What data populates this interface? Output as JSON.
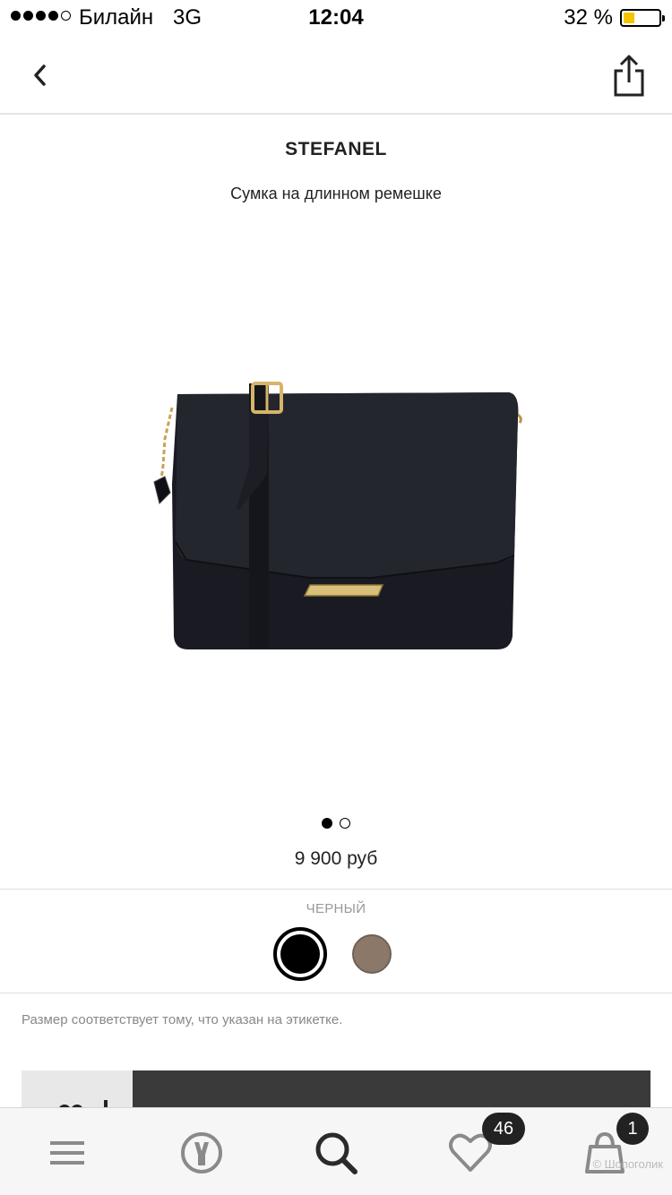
{
  "status_bar": {
    "carrier": "Билайн",
    "network": "3G",
    "time": "12:04",
    "battery_percent_text": "32 %",
    "battery_level": 0.32,
    "signal_bars_filled": 4,
    "signal_bars_total": 5
  },
  "nav": {
    "back_icon": "chevron-left-icon",
    "share_icon": "share-icon"
  },
  "product": {
    "brand": "STEFANEL",
    "name": "Сумка на длинном ремешке",
    "price": "9 900 руб",
    "image_count": 2,
    "active_image_index": 0
  },
  "colors": {
    "selected_label": "ЧЕРНЫЙ",
    "swatches": [
      "#000000",
      "#8b7868"
    ]
  },
  "size_note": "Размер соответствует тому, что указан на этикетке.",
  "tab_bar": {
    "items": [
      {
        "icon": "menu-icon"
      },
      {
        "icon": "brands-icon"
      },
      {
        "icon": "search-icon"
      },
      {
        "icon": "heart-icon",
        "badge": "46"
      },
      {
        "icon": "bag-icon",
        "badge": "1"
      }
    ]
  },
  "watermark": "© Шопоголик"
}
